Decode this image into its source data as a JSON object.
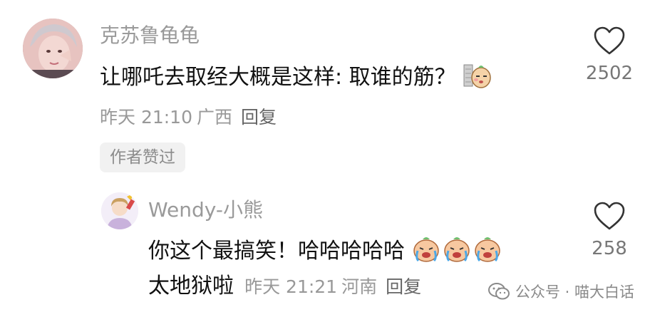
{
  "comments": [
    {
      "username": "克苏鲁龟龟",
      "text": "让哪吒去取经大概是这样: 取谁的筋？",
      "time": "昨天 21:10",
      "location": "广西",
      "reply_label": "回复",
      "badge": "作者赞过",
      "like_count": "2502",
      "emoji": "facepalm-sticker"
    },
    {
      "username": "Wendy-小熊",
      "text_line1": "你这个最搞笑！哈哈哈哈哈",
      "text_line2": "太地狱啦",
      "time": "昨天 21:21",
      "location": "河南",
      "reply_label": "回复",
      "like_count": "258",
      "emoji": "crying-laughing-sticker"
    }
  ],
  "watermark": {
    "label": "公众号 · 喵大白话",
    "icon": "wechat-icon"
  },
  "colors": {
    "username": "#9a9a9a",
    "meta": "#999999",
    "badge_bg": "#f1f1f1"
  }
}
